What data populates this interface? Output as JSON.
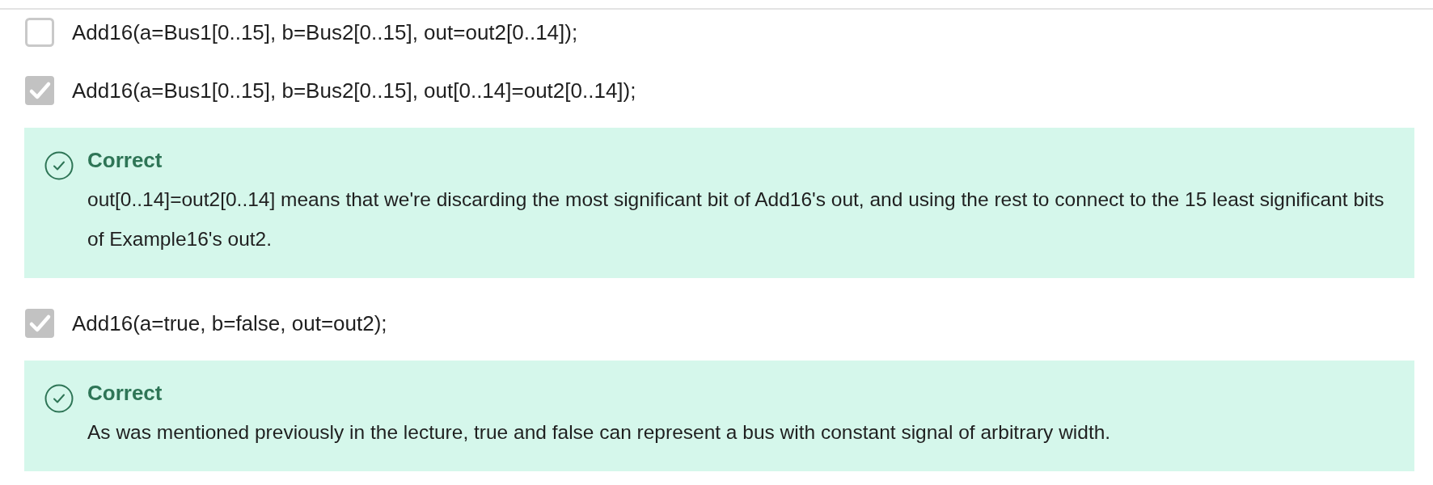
{
  "options": [
    {
      "text": "Add16(a=Bus1[0..15], b=Bus2[0..15], out=out2[0..14]);",
      "checked": false
    },
    {
      "text": "Add16(a=Bus1[0..15], b=Bus2[0..15], out[0..14]=out2[0..14]);",
      "checked": true,
      "feedback": {
        "title": "Correct",
        "body": "out[0..14]=out2[0..14] means that we're discarding the most significant bit of Add16's out, and using the rest to connect to the 15 least significant bits of Example16's out2."
      }
    },
    {
      "text": "Add16(a=true, b=false, out=out2);",
      "checked": true,
      "feedback": {
        "title": "Correct",
        "body": "As was mentioned previously in the lecture, true and false can represent a bus with constant signal of arbitrary width."
      }
    }
  ]
}
